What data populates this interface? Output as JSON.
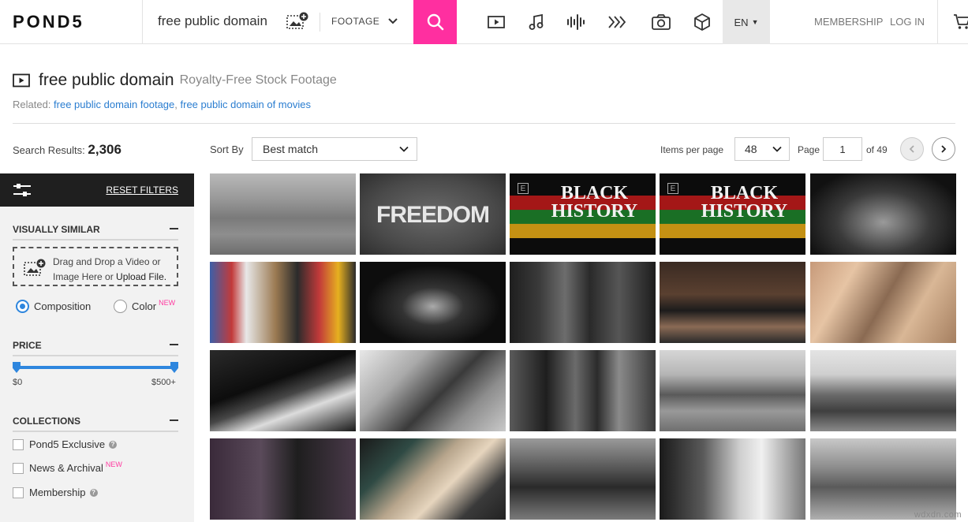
{
  "header": {
    "logo": "POND5",
    "search_query": "free public domain",
    "media_type": "FOOTAGE",
    "lang": "EN",
    "membership": "MEMBERSHIP",
    "login": "LOG IN",
    "media_icons": [
      "video-icon",
      "music-icon",
      "sound-effects-icon",
      "after-effects-icon",
      "photo-icon",
      "3d-model-icon"
    ],
    "accent_color": "#ff2fa0"
  },
  "page": {
    "title": "free public domain",
    "subtitle": "Royalty-Free Stock Footage",
    "related_label": "Related:",
    "related_links": [
      "free public domain footage",
      "free public domain of movies"
    ],
    "results_label": "Search Results:",
    "results_count": "2,306",
    "sort_label": "Sort By",
    "sort_value": "Best match",
    "ipp_label": "Items per page",
    "ipp_value": "48",
    "page_label": "Page",
    "page_value": "1",
    "page_of": "of 49"
  },
  "sidebar": {
    "reset": "RESET FILTERS",
    "visually_similar": "VISUALLY SIMILAR",
    "drop_line1": "Drag and Drop a Video or",
    "drop_line2a": "Image Here or ",
    "drop_line2b": "Upload File.",
    "radio_composition": "Composition",
    "radio_color": "Color",
    "new_tag": "NEW",
    "price": "PRICE",
    "price_min": "$0",
    "price_max": "$500+",
    "price_range_fraction": [
      0,
      1
    ],
    "collections": "COLLECTIONS",
    "collection_items": [
      "Pond5 Exclusive",
      "News & Archival",
      "Membership"
    ]
  },
  "thumbnails": [
    {
      "text": "",
      "bg": "linear-gradient(180deg,#b9b9b9 0%,#9a9a9a 30%,#7a7a7a 55%,#8e8e8e 75%,#6d6d6d 100%)"
    },
    {
      "text": "FREEDOM",
      "bg": "radial-gradient(ellipse at 50% 50%,#6a6a6a 0%,#4a4a4a 60%,#2e2e2e 100%)"
    },
    {
      "text": "BLACK HISTORY",
      "bg": "#0c0c0c"
    },
    {
      "text": "BLACK HISTORY",
      "bg": "#0c0c0c"
    },
    {
      "text": "",
      "bg": "radial-gradient(ellipse at 50% 60%,#9a9a9a 0%,#3a3a3a 45%,#111 80%)"
    },
    {
      "text": "",
      "bg": "linear-gradient(90deg,#3d5fa8 0%,#c23a3a 15%,#e8e8e8 25%,#9b7a52 45%,#2b2b2b 60%,#c23a3a 75%,#e6b020 88%,#2b2b2b 100%)"
    },
    {
      "text": "",
      "bg": "radial-gradient(ellipse at 50% 55%,#aaa 0%,#333 30%,#0d0d0d 65%)"
    },
    {
      "text": "",
      "bg": "linear-gradient(90deg,#1e1e1e 0%,#3a3a3a 20%,#6d6d6d 38%,#2a2a2a 55%,#565656 75%,#1d1d1d 100%)"
    },
    {
      "text": "",
      "bg": "linear-gradient(180deg,#3a2a22 0%,#5a4030 40%,#1c1c1c 60%,#8a6a55 80%,#2a2a2a 100%)"
    },
    {
      "text": "",
      "bg": "linear-gradient(120deg,#c79a7a 0%,#e6c4a4 25%,#8a6a52 50%,#d9b796 70%,#a57f60 100%)"
    },
    {
      "text": "",
      "bg": "linear-gradient(160deg,#2a2a2a 0%,#0d0d0d 40%,#474747 55%,#dcdcdc 70%,#777 85%,#1a1a1a 100%)"
    },
    {
      "text": "",
      "bg": "linear-gradient(135deg,#e8e8e8 0%,#a9a9a9 30%,#3a3a3a 55%,#8d8d8d 75%,#c9c9c9 100%)"
    },
    {
      "text": "",
      "bg": "linear-gradient(90deg,#5a5a5a 0%,#1e1e1e 25%,#6b6b6b 45%,#2b2b2b 60%,#8a8a8a 75%,#3a3a3a 100%)"
    },
    {
      "text": "",
      "bg": "linear-gradient(180deg,#d6d6d6 0%,#b5b5b5 30%,#5a5a5a 55%,#999 75%,#6f6f6f 100%)"
    },
    {
      "text": "",
      "bg": "linear-gradient(180deg,#e4e4e4 0%,#cfcfcf 30%,#6a6a6a 55%,#3f3f3f 75%,#8a8a8a 100%)"
    },
    {
      "text": "",
      "bg": "linear-gradient(90deg,#3a2a3a 0%,#5a4a5a 35%,#1e1e1e 60%,#4a3a4a 100%)"
    },
    {
      "text": "",
      "bg": "linear-gradient(135deg,#1a1a1a 0%,#2f4a44 25%,#b7a58c 45%,#e6d5be 60%,#3a3a3a 80%,#222 100%)"
    },
    {
      "text": "",
      "bg": "linear-gradient(180deg,#9a9a9a 0%,#5a5a5a 35%,#2a2a2a 60%,#7a7a7a 100%)"
    },
    {
      "text": "",
      "bg": "linear-gradient(90deg,#1a1a1a 0%,#5a5a5a 30%,#cfcfcf 55%,#f0f0f0 70%,#777 100%)"
    },
    {
      "text": "",
      "bg": "linear-gradient(180deg,#c8c8c8 0%,#8e8e8e 35%,#5a5a5a 60%,#b0b0b0 100%)"
    }
  ],
  "watermark": "wdxdn.com"
}
